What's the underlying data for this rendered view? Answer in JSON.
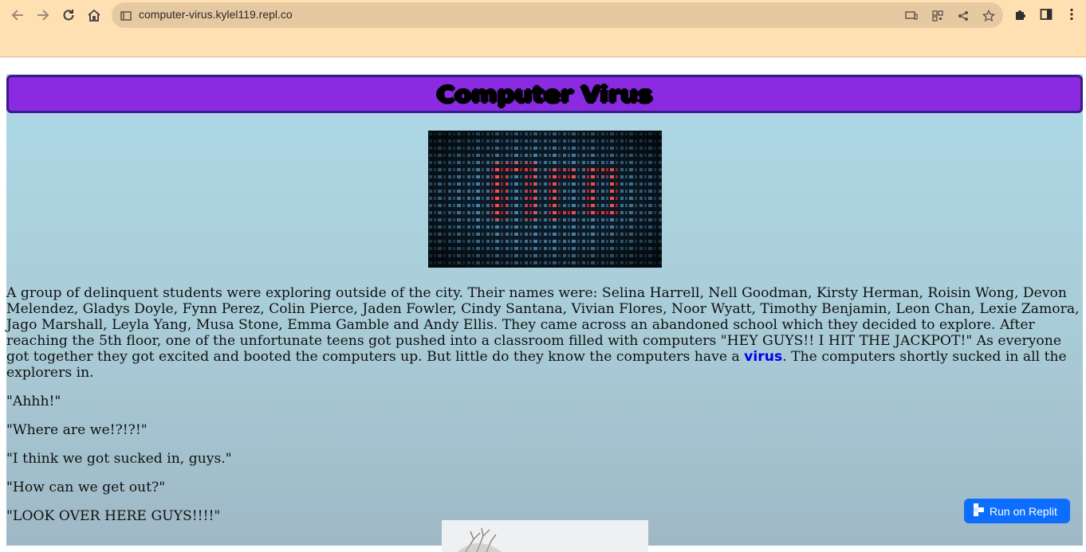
{
  "browser": {
    "url": "computer-virus.kylel119.repl.co",
    "icons": [
      "back-arrow-icon",
      "forward-arrow-icon",
      "reload-icon",
      "home-icon",
      "site-info-icon",
      "cast-icon",
      "qr-icon",
      "share-icon",
      "star-icon",
      "extensions-icon",
      "side-panel-icon",
      "menu-icon"
    ]
  },
  "page": {
    "title": "Computer Virus",
    "intro_before_link": "A group of delinquent students were exploring outside of the city. Their names were: Selina Harrell, Nell Goodman, Kirsty Herman, Roisin Wong, Devon Melendez, Gladys Doyle, Fynn Perez, Colin Pierce, Jaden Fowler, Cindy Santana, Vivian Flores, Noor Wyatt, Timothy Benjamin, Leon Chan, Lexie Zamora, Jago Marshall, Leyla Yang, Musa Stone, Emma Gamble and Andy Ellis. They came across an abandoned school which they decided to explore. After reaching the 5th floor, one of the unfortunate teens got pushed into a classroom filled with computers \"HEY GUYS!! I HIT THE JACKPOT!\" As everyone got together they got excited and booted the computers up. But little do they know the computers have a ",
    "link_text": "virus",
    "intro_after_link": ". The computers shortly sucked in all the explorers in.",
    "dialogue": [
      "\"Ahhh!\"",
      "\"Where are we!?!?!\"",
      "\"I think we got sucked in, guys.\"",
      "\"How can we get out?\"",
      "\"LOOK OVER HERE GUYS!!!!\""
    ]
  },
  "replit": {
    "label": "Run on Replit"
  },
  "colors": {
    "title_bg": "#8a2be2",
    "page_bg": "#add8e6",
    "chrome_bg": "#ffe0b2",
    "link": "#0000ee",
    "replit_btn": "#0d6efd"
  }
}
